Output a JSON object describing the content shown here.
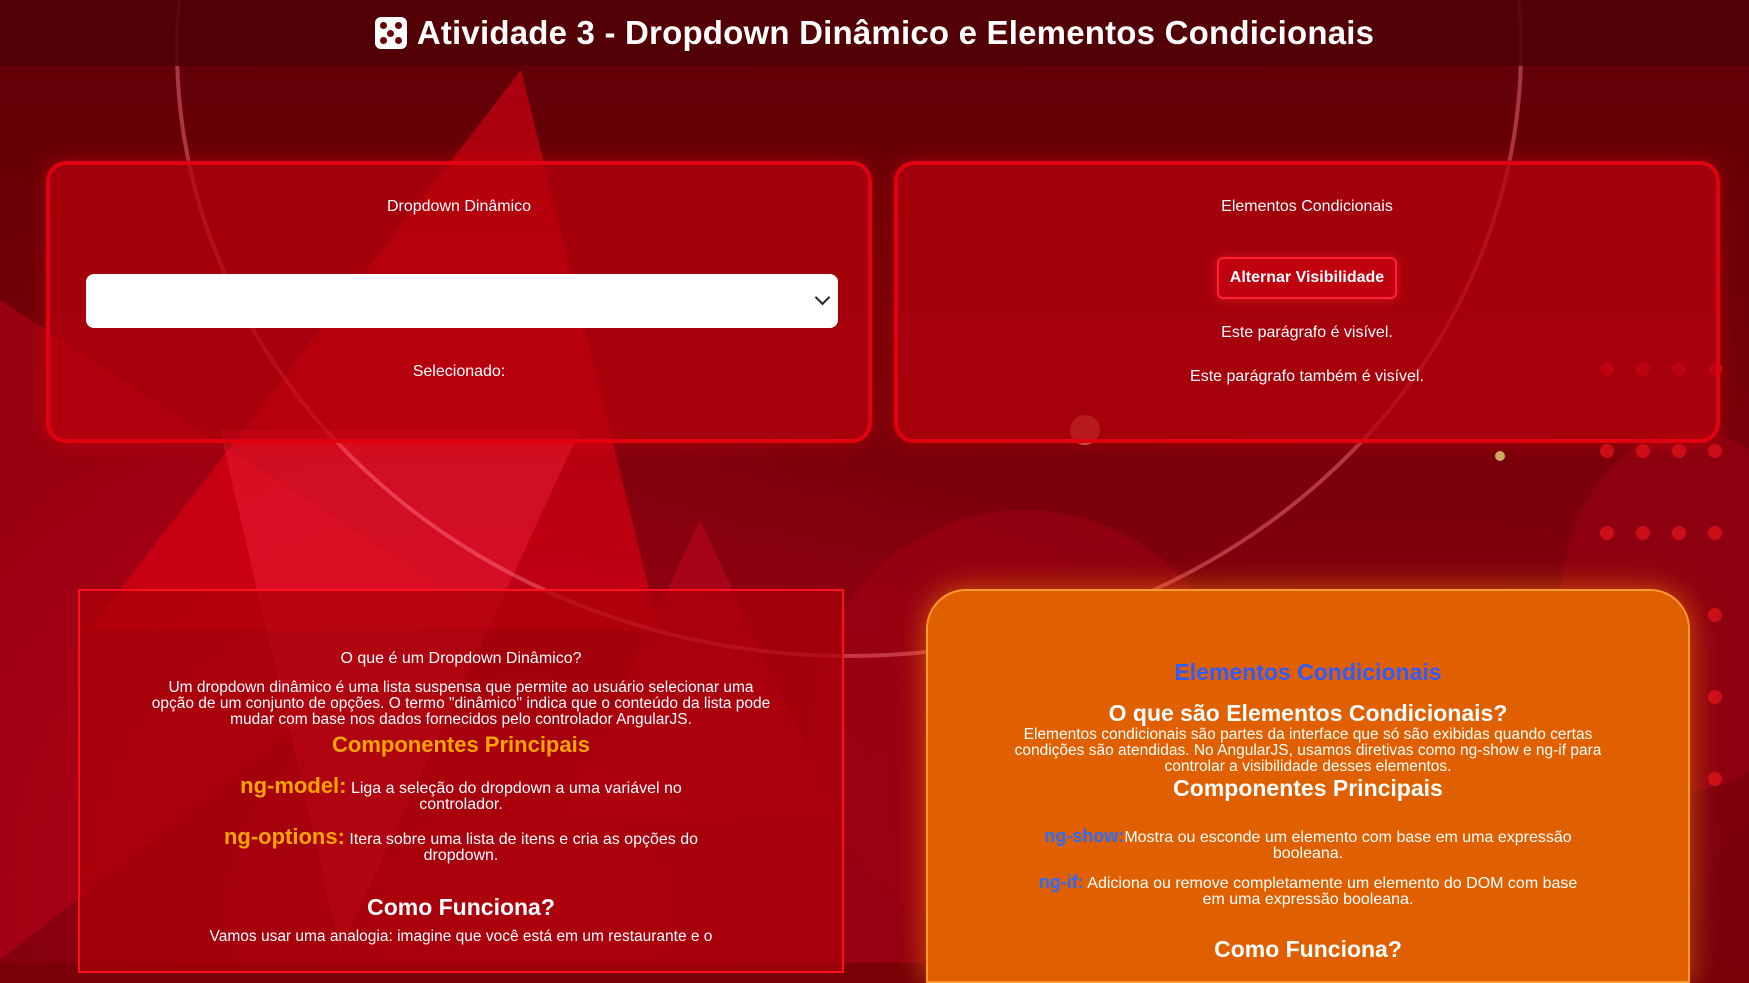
{
  "header": {
    "title": "Atividade 3 - Dropdown Dinâmico e Elementos Condicionais"
  },
  "dropdown_card": {
    "title": "Dropdown Dinâmico",
    "select_value": "",
    "selected_label": "Selecionado:"
  },
  "conditional_card": {
    "title": "Elementos Condicionais",
    "toggle_button": "Alternar Visibilidade",
    "paragraph1": "Este parágrafo é visível.",
    "paragraph2": "Este parágrafo também é visível."
  },
  "dropdown_info": {
    "question": "O que é um Dropdown Dinâmico?",
    "description": "Um dropdown dinâmico é uma lista suspensa que permite ao usuário selecionar uma opção de um conjunto de opções. O termo \"dinâmico\" indica que o conteúdo da lista pode mudar com base nos dados fornecidos pelo controlador AngularJS.",
    "components_heading": "Componentes Principais",
    "components": [
      {
        "key": "ng-model:",
        "text": " Liga a seleção do dropdown a uma variável no controlador."
      },
      {
        "key": "ng-options:",
        "text": " Itera sobre uma lista de itens e cria as opções do dropdown."
      }
    ],
    "how_heading": "Como Funciona?",
    "how_text": "Vamos usar uma analogia: imagine que você está em um restaurante e o"
  },
  "conditional_info": {
    "title": "Elementos Condicionais",
    "question": "O que são Elementos Condicionais?",
    "description": "Elementos condicionais são partes da interface que só são exibidas quando certas condições são atendidas. No AngularJS, usamos diretivas como ng-show e ng-if para controlar a visibilidade desses elementos.",
    "components_heading": "Componentes Principais",
    "components": [
      {
        "key": "ng-show:",
        "text": "Mostra ou esconde um elemento com base em uma expressão booleana."
      },
      {
        "key": "ng-if:",
        "text": " Adiciona ou remove completamente um elemento do DOM com base em uma expressão booleana."
      }
    ],
    "how_heading": "Como Funciona?"
  },
  "icons": {
    "title_icon": "dice-icon",
    "select_icon": "chevron-down-icon"
  },
  "colors": {
    "accent_red": "#e00010",
    "orange_panel": "#e06000",
    "orange_text": "#ffa500",
    "blue_text": "#2f5bff"
  }
}
